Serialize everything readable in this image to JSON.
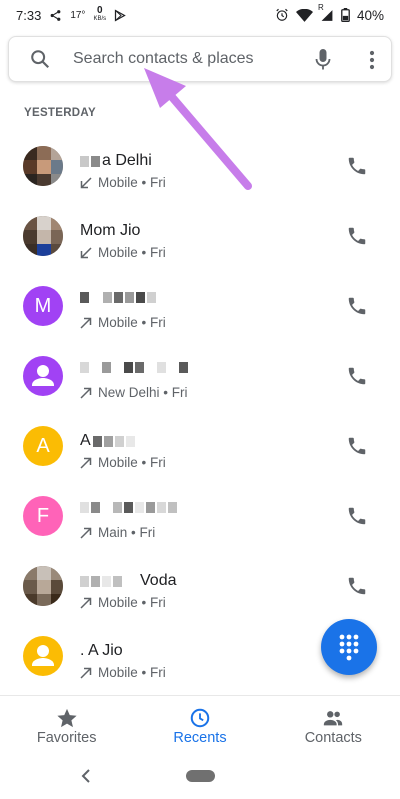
{
  "status_bar": {
    "time": "7:33",
    "temperature": "17°",
    "data_speed_value": "0",
    "data_speed_unit": "KB/s",
    "network_badge": "R",
    "battery": "40%"
  },
  "search": {
    "placeholder": "Search contacts & places"
  },
  "section": {
    "header": "YESTERDAY"
  },
  "calls": [
    {
      "avatar_letter": "",
      "avatar_color": "#6d5a4a",
      "name": "a Delhi",
      "direction": "incoming",
      "detail": "Mobile • Fri"
    },
    {
      "avatar_letter": "",
      "avatar_color": "#4a3b2e",
      "name": "Mom Jio",
      "direction": "incoming",
      "detail": "Mobile • Fri"
    },
    {
      "avatar_letter": "M",
      "avatar_color": "#a142f4",
      "name": "",
      "direction": "outgoing",
      "detail": "Mobile • Fri"
    },
    {
      "avatar_letter": "",
      "avatar_color": "#a142f4",
      "name": "",
      "direction": "outgoing",
      "detail": "New Delhi • Fri"
    },
    {
      "avatar_letter": "A",
      "avatar_color": "#fbbc04",
      "name": "A",
      "direction": "outgoing",
      "detail": "Mobile • Fri"
    },
    {
      "avatar_letter": "F",
      "avatar_color": "#ff63b8",
      "name": "",
      "direction": "outgoing",
      "detail": "Main • Fri"
    },
    {
      "avatar_letter": "",
      "avatar_color": "#7a6a5a",
      "name": "Voda",
      "direction": "outgoing",
      "detail": "Mobile • Fri"
    },
    {
      "avatar_letter": "",
      "avatar_color": "#fbbc04",
      "name": ". A Jio",
      "direction": "outgoing",
      "detail": "Mobile • Fri"
    }
  ],
  "bottom_nav": {
    "items": [
      {
        "label": "Favorites",
        "icon": "star-icon"
      },
      {
        "label": "Recents",
        "icon": "clock-icon"
      },
      {
        "label": "Contacts",
        "icon": "people-icon"
      }
    ],
    "active": "Recents"
  },
  "colors": {
    "accent": "#1a73e8",
    "annotation_arrow": "#c77dea",
    "secondary_text": "#5f6368"
  }
}
